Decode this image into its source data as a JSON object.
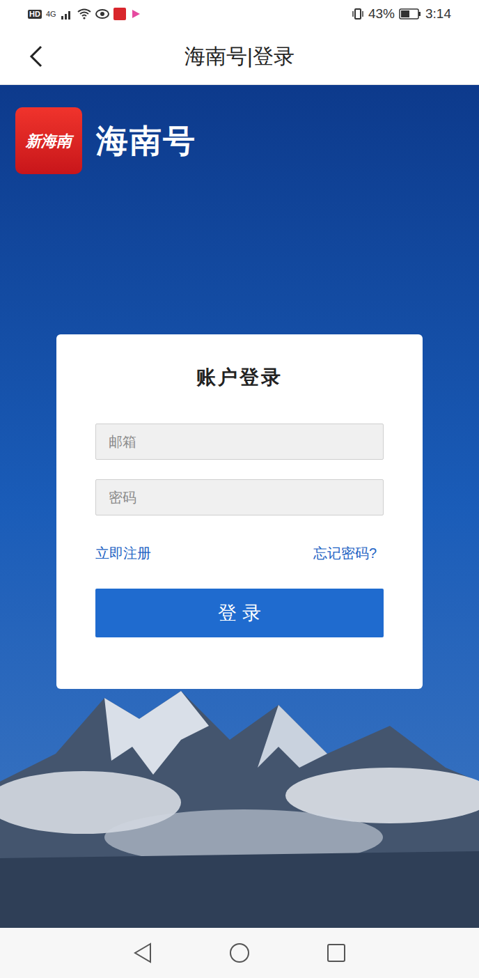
{
  "status_bar": {
    "left": [
      "HD",
      "4G"
    ],
    "battery": "43%",
    "time": "3:14"
  },
  "header": {
    "title": "海南号|登录"
  },
  "brand": {
    "logo_text": "新海南",
    "name": "海南号"
  },
  "login": {
    "title": "账户登录",
    "fields": [
      {
        "placeholder": "邮箱",
        "type": "text"
      },
      {
        "placeholder": "密码",
        "type": "password"
      }
    ],
    "links": [
      "立即注册",
      "忘记密码?"
    ],
    "button": "登 录"
  }
}
